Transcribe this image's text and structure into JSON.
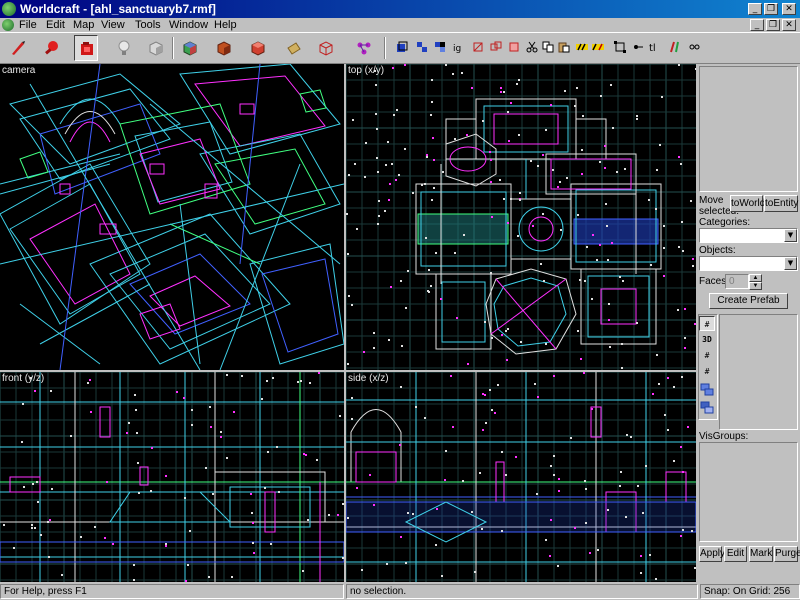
{
  "window": {
    "title": "Worldcraft - [ahl_sanctuaryb7.rmf]"
  },
  "menu": [
    "File",
    "Edit",
    "Map",
    "View",
    "Tools",
    "Window",
    "Help"
  ],
  "viewports": {
    "camera": "camera",
    "top": "top (x/y)",
    "front": "front (y/z)",
    "side": "side (x/z)"
  },
  "panel": {
    "move_selected_line1": "Move",
    "move_selected_line2": "selected:",
    "to_world": "toWorld",
    "to_entity": "toEntity",
    "categories_label": "Categories:",
    "objects_label": "Objects:",
    "faces_label": "Faces:",
    "faces_value": "0",
    "create_prefab": "Create Prefab",
    "visgroups_label": "VisGroups:",
    "apply": "Apply",
    "edit": "Edit",
    "mark": "Mark",
    "purge": "Purge"
  },
  "status": {
    "help": "For Help, press F1",
    "selection": "no selection.",
    "snap": "Snap: On Grid: 256"
  },
  "colors": {
    "wire_cyan": "#3fd0e8",
    "wire_magenta": "#ff30ff",
    "wire_green": "#40ff80",
    "wire_blue": "#4060ff",
    "wire_white": "#e0e0e0",
    "grid": "#1a3838",
    "grid_major": "#245050"
  }
}
